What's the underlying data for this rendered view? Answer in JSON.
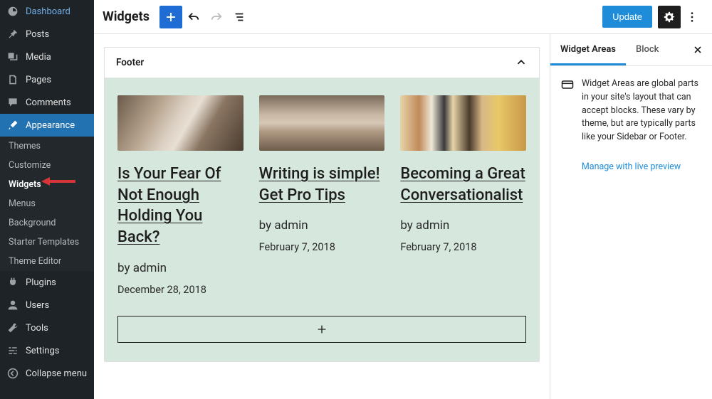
{
  "sidebar": {
    "items": [
      {
        "name": "dashboard",
        "label": "Dashboard"
      },
      {
        "name": "posts",
        "label": "Posts"
      },
      {
        "name": "media",
        "label": "Media"
      },
      {
        "name": "pages",
        "label": "Pages"
      },
      {
        "name": "comments",
        "label": "Comments"
      },
      {
        "name": "appearance",
        "label": "Appearance"
      },
      {
        "name": "plugins",
        "label": "Plugins"
      },
      {
        "name": "users",
        "label": "Users"
      },
      {
        "name": "tools",
        "label": "Tools"
      },
      {
        "name": "settings",
        "label": "Settings"
      },
      {
        "name": "collapse",
        "label": "Collapse menu"
      }
    ],
    "appearance_sub": [
      {
        "name": "themes",
        "label": "Themes"
      },
      {
        "name": "customize",
        "label": "Customize"
      },
      {
        "name": "widgets",
        "label": "Widgets"
      },
      {
        "name": "menus",
        "label": "Menus"
      },
      {
        "name": "background",
        "label": "Background"
      },
      {
        "name": "starter-templates",
        "label": "Starter Templates"
      },
      {
        "name": "theme-editor",
        "label": "Theme Editor"
      }
    ]
  },
  "topbar": {
    "title": "Widgets",
    "update": "Update"
  },
  "panel": {
    "title": "Footer"
  },
  "posts": [
    {
      "title": "Is Your Fear Of Not Enough Holding You Back?",
      "author": "by admin",
      "date": "December 28, 2018"
    },
    {
      "title": "Writing is simple! Get Pro Tips",
      "author": "by admin",
      "date": "February 7, 2018"
    },
    {
      "title": "Becoming a Great Conversationalist",
      "author": "by admin",
      "date": "February 7, 2018"
    }
  ],
  "inspector": {
    "tabs": {
      "areas": "Widget Areas",
      "block": "Block"
    },
    "desc": "Widget Areas are global parts in your site's layout that can accept blocks. These vary by theme, but are typically parts like your Sidebar or Footer.",
    "link": "Manage with live preview"
  }
}
